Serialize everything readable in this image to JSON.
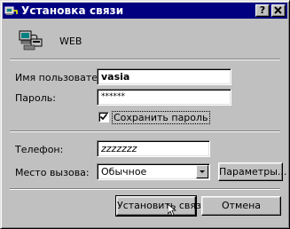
{
  "window": {
    "title": "Установка связи",
    "help_button": "?",
    "close_button": "✕"
  },
  "connection": {
    "name": "WEB"
  },
  "fields": {
    "username_label": "Имя пользователя:",
    "username_value": "vasia",
    "password_label": "Пароль:",
    "password_value": "******",
    "save_password_label": "Сохранить пароль",
    "save_password_checked": true,
    "phone_label": "Телефон:",
    "phone_value": "zzzzzzz",
    "dial_from_label": "Место вызова:",
    "dial_from_value": "Обычное"
  },
  "buttons": {
    "params": "Параметры...",
    "connect": "Установить связь",
    "cancel": "Отмена"
  },
  "colors": {
    "titlebar": "#000080",
    "face": "#c0c0c0"
  }
}
